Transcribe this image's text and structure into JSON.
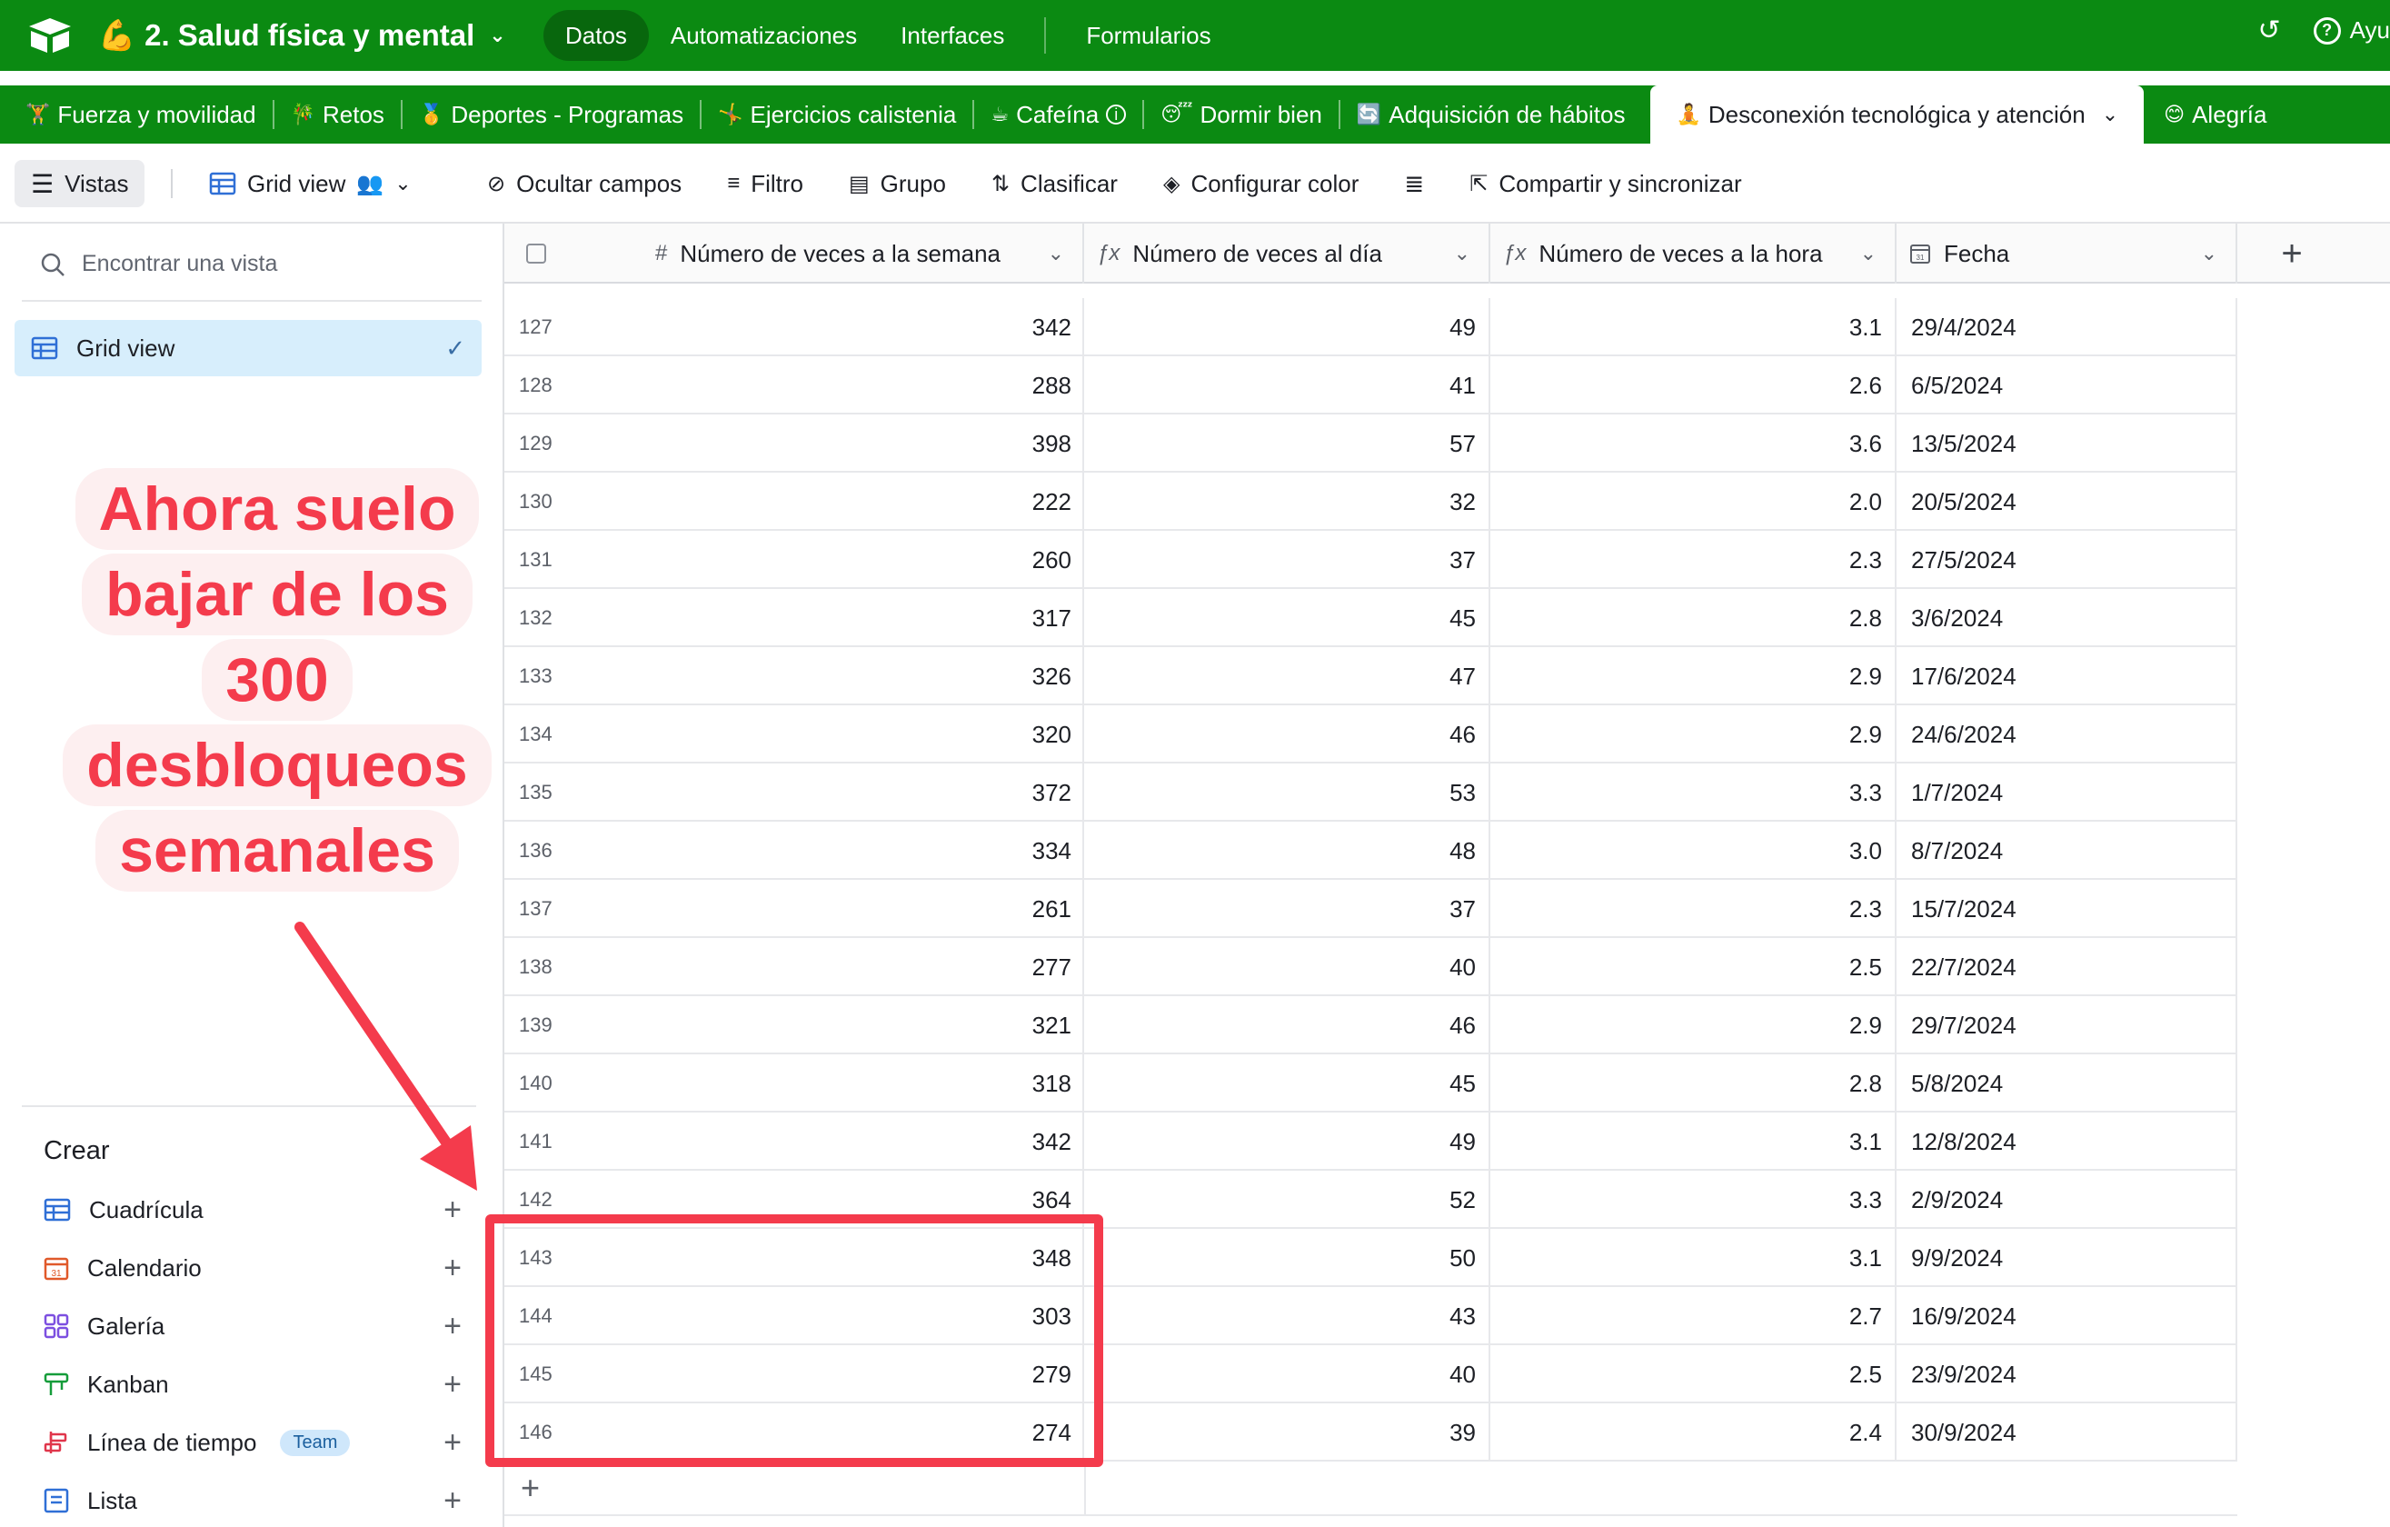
{
  "topbar": {
    "base_emoji": "💪",
    "base_title": "2. Salud física y mental",
    "nav": [
      "Datos",
      "Automatizaciones",
      "Interfaces",
      "Formularios"
    ],
    "help_label": "Ayu"
  },
  "tables": [
    {
      "emoji": "🏋",
      "label": "Fuerza y movilidad"
    },
    {
      "emoji": "🎋",
      "label": "Retos"
    },
    {
      "emoji": "🥇",
      "label": "Deportes - Programas"
    },
    {
      "emoji": "🤸",
      "label": "Ejercicios calistenia"
    },
    {
      "emoji": "☕",
      "label": "Cafeína"
    },
    {
      "emoji": "😴",
      "label": "Dormir bien"
    },
    {
      "emoji": "🔄",
      "label": "Adquisición de hábitos"
    },
    {
      "emoji": "🧘",
      "label": "Desconexión tecnológica y atención"
    },
    {
      "emoji": "😊",
      "label": "Alegría"
    }
  ],
  "viewbar": {
    "vistas": "Vistas",
    "view_name": "Grid view",
    "tools": [
      "Ocultar campos",
      "Filtro",
      "Grupo",
      "Clasificar",
      "Configurar color",
      "Compartir y sincronizar"
    ]
  },
  "sidebar": {
    "search_placeholder": "Encontrar una vista",
    "active_view": "Grid view",
    "crear_title": "Crear",
    "create_items": [
      {
        "icon": "grid-icon",
        "label": "Cuadrícula",
        "color": "#2f6fd6"
      },
      {
        "icon": "calendar-icon",
        "label": "Calendario",
        "color": "#e0592a"
      },
      {
        "icon": "gallery-icon",
        "label": "Galería",
        "color": "#7c4fe0"
      },
      {
        "icon": "kanban-icon",
        "label": "Kanban",
        "color": "#159c3a"
      },
      {
        "icon": "timeline-icon",
        "label": "Línea de tiempo",
        "badge": "Team",
        "color": "#e0364b"
      },
      {
        "icon": "list-icon",
        "label": "Lista",
        "color": "#2f6fd6"
      }
    ]
  },
  "callout": {
    "lines": [
      "Ahora suelo",
      "bajar de los",
      "300",
      "desbloqueos",
      "semanales"
    ],
    "color": "#f43b4c"
  },
  "columns": [
    {
      "type_icon": "#",
      "label": "Número de veces a la semana"
    },
    {
      "type_icon": "fx",
      "label": "Número de veces al día"
    },
    {
      "type_icon": "fx",
      "label": "Número de veces a la hora"
    },
    {
      "type_icon": "date",
      "label": "Fecha"
    }
  ],
  "rows": [
    {
      "n": "127",
      "semana": "342",
      "dia": "49",
      "hora": "3.1",
      "fecha": "29/4/2024"
    },
    {
      "n": "128",
      "semana": "288",
      "dia": "41",
      "hora": "2.6",
      "fecha": "6/5/2024"
    },
    {
      "n": "129",
      "semana": "398",
      "dia": "57",
      "hora": "3.6",
      "fecha": "13/5/2024"
    },
    {
      "n": "130",
      "semana": "222",
      "dia": "32",
      "hora": "2.0",
      "fecha": "20/5/2024"
    },
    {
      "n": "131",
      "semana": "260",
      "dia": "37",
      "hora": "2.3",
      "fecha": "27/5/2024"
    },
    {
      "n": "132",
      "semana": "317",
      "dia": "45",
      "hora": "2.8",
      "fecha": "3/6/2024"
    },
    {
      "n": "133",
      "semana": "326",
      "dia": "47",
      "hora": "2.9",
      "fecha": "17/6/2024"
    },
    {
      "n": "134",
      "semana": "320",
      "dia": "46",
      "hora": "2.9",
      "fecha": "24/6/2024"
    },
    {
      "n": "135",
      "semana": "372",
      "dia": "53",
      "hora": "3.3",
      "fecha": "1/7/2024"
    },
    {
      "n": "136",
      "semana": "334",
      "dia": "48",
      "hora": "3.0",
      "fecha": "8/7/2024"
    },
    {
      "n": "137",
      "semana": "261",
      "dia": "37",
      "hora": "2.3",
      "fecha": "15/7/2024"
    },
    {
      "n": "138",
      "semana": "277",
      "dia": "40",
      "hora": "2.5",
      "fecha": "22/7/2024"
    },
    {
      "n": "139",
      "semana": "321",
      "dia": "46",
      "hora": "2.9",
      "fecha": "29/7/2024"
    },
    {
      "n": "140",
      "semana": "318",
      "dia": "45",
      "hora": "2.8",
      "fecha": "5/8/2024"
    },
    {
      "n": "141",
      "semana": "342",
      "dia": "49",
      "hora": "3.1",
      "fecha": "12/8/2024"
    },
    {
      "n": "142",
      "semana": "364",
      "dia": "52",
      "hora": "3.3",
      "fecha": "2/9/2024"
    },
    {
      "n": "143",
      "semana": "348",
      "dia": "50",
      "hora": "3.1",
      "fecha": "9/9/2024"
    },
    {
      "n": "144",
      "semana": "303",
      "dia": "43",
      "hora": "2.7",
      "fecha": "16/9/2024"
    },
    {
      "n": "145",
      "semana": "279",
      "dia": "40",
      "hora": "2.5",
      "fecha": "23/9/2024"
    },
    {
      "n": "146",
      "semana": "274",
      "dia": "39",
      "hora": "2.4",
      "fecha": "30/9/2024"
    }
  ],
  "highlight": {
    "rows": [
      "143",
      "144",
      "145",
      "146"
    ],
    "column": "Número de veces a la semana"
  },
  "colors": {
    "topbar": "#0b8a12",
    "accent_red": "#f43b4c",
    "selected_view": "#d7eefc"
  }
}
